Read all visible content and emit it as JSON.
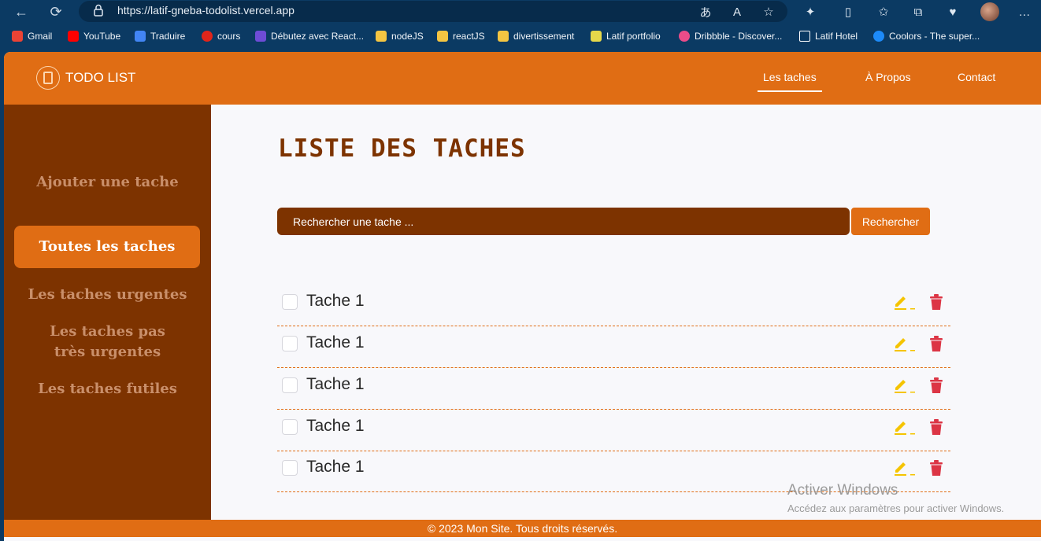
{
  "browser": {
    "url": "https://latif-gneba-todolist.vercel.app",
    "bookmarks": [
      {
        "label": "Gmail",
        "color": "#ea4335"
      },
      {
        "label": "YouTube",
        "color": "#ff0000"
      },
      {
        "label": "Traduire",
        "color": "#4285f4"
      },
      {
        "label": "cours",
        "color": "#e0251b"
      },
      {
        "label": "Débutez avec React...",
        "color": "#6e4cd6"
      },
      {
        "label": "nodeJS",
        "color": "#f4c542"
      },
      {
        "label": "reactJS",
        "color": "#f4c542"
      },
      {
        "label": "divertissement",
        "color": "#f4c542"
      },
      {
        "label": "Latif portfolio",
        "color": "#e6d84a"
      },
      {
        "label": "Dribbble - Discover...",
        "color": "#ea4c89"
      },
      {
        "label": "Latif Hotel",
        "color": "#ffffff"
      },
      {
        "label": "Coolors - The super...",
        "color": "#1d8af8"
      }
    ]
  },
  "header": {
    "logo_text": "TODO LIST",
    "nav": [
      "Les taches",
      "À Propos",
      "Contact"
    ]
  },
  "sidebar": {
    "items": [
      "Ajouter une tache",
      "Toutes les taches",
      "Les taches urgentes",
      "Les taches pas très urgentes",
      "Les taches futiles"
    ]
  },
  "main": {
    "title": "LISTE DES TACHES",
    "search_placeholder": "Rechercher une tache ...",
    "search_button": "Rechercher",
    "tasks": [
      "Tache 1",
      "Tache 1",
      "Tache 1",
      "Tache 1",
      "Tache 1"
    ]
  },
  "footer": {
    "text": "© 2023 Mon Site. Tous droits réservés."
  },
  "watermark": {
    "title": "Activer Windows",
    "subtitle": "Accédez aux paramètres pour activer Windows."
  },
  "colors": {
    "header": "#e06d14",
    "sidebar": "#7d3300",
    "edit_icon": "#f5c400",
    "delete_icon": "#dc3545"
  },
  "icons": {
    "back": "arrow-left-icon",
    "refresh": "refresh-icon",
    "lock": "lock-icon",
    "edit": "pencil-icon",
    "delete": "trash-icon"
  }
}
